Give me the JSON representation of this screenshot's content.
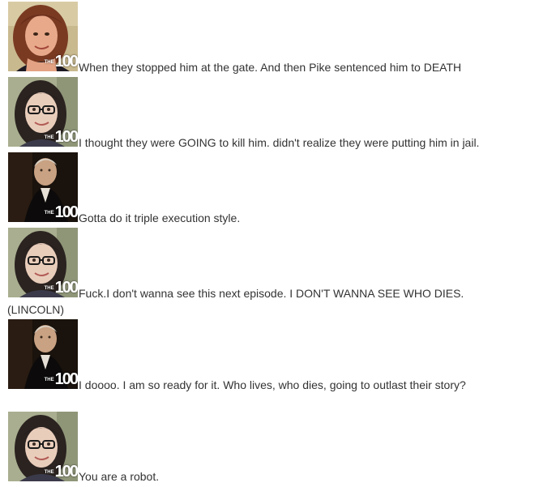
{
  "logo": {
    "small": "THE",
    "big": "100"
  },
  "messages": [
    {
      "avatar": "redhead-woman-avatar",
      "text": "When they stopped him at the gate. And then Pike sentenced him to DEATH"
    },
    {
      "avatar": "glasses-woman-avatar",
      "text": "I thought they were GOING to kill him.  didn't realize they were putting him in jail."
    },
    {
      "avatar": "hamilton-portrait-avatar",
      "text": "Gotta do it triple execution style."
    },
    {
      "avatar": "glasses-woman-avatar",
      "text": "Fuck.I don't wanna see this next episode. I DON'T WANNA SEE WHO DIES.",
      "continuation": "(LINCOLN)"
    },
    {
      "avatar": "hamilton-portrait-avatar",
      "text": "I doooo. I am so ready for it. Who lives, who dies, going to outlast their story?"
    },
    {
      "avatar": "glasses-woman-avatar",
      "text": "You are a robot."
    }
  ]
}
